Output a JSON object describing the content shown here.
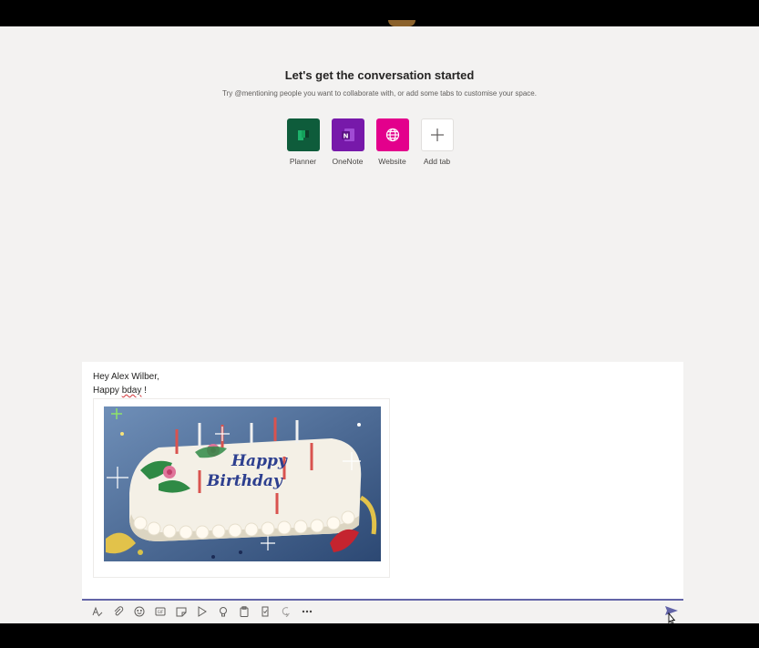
{
  "welcome": {
    "title": "Let's get the conversation started",
    "subtitle": "Try @mentioning people you want to collaborate with, or add some tabs to customise your space."
  },
  "tiles": [
    {
      "label": "Planner",
      "icon": "planner-icon",
      "color": "#0e5c3b"
    },
    {
      "label": "OneNote",
      "icon": "onenote-icon",
      "color": "#7719aa"
    },
    {
      "label": "Website",
      "icon": "globe-icon",
      "color": "#e3008c"
    },
    {
      "label": "Add tab",
      "icon": "plus-icon",
      "color": "#ffffff"
    }
  ],
  "compose": {
    "line1": "Hey Alex Wilber,",
    "line2_pre": "Happy ",
    "line2_word": "bday",
    "line2_post": " !",
    "gif_text": "Happy Birthday"
  },
  "toolbar": {
    "icons": [
      "format-icon",
      "attach-icon",
      "emoji-icon",
      "gif-icon",
      "sticker-icon",
      "meet-now-icon",
      "praise-icon",
      "clipboard-icon",
      "approvals-icon",
      "loop-icon",
      "more-options-icon"
    ],
    "send_icon": "send-icon",
    "accent_color": "#6264a7"
  }
}
